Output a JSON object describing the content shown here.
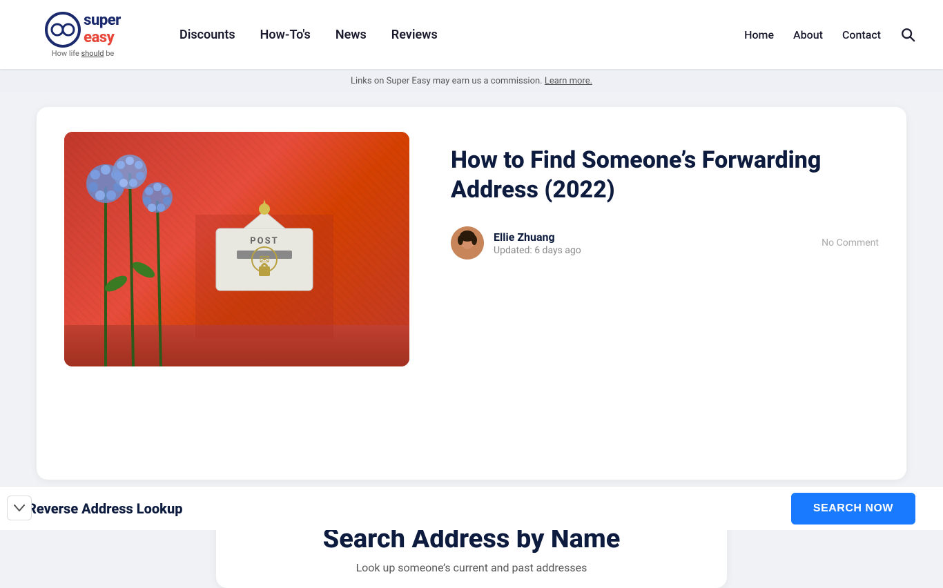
{
  "brand": {
    "super": "super",
    "easy": "easy",
    "tagline_pre": "How life ",
    "tagline_em": "should",
    "tagline_post": " be"
  },
  "nav": {
    "items": [
      {
        "label": "Discounts",
        "id": "discounts"
      },
      {
        "label": "How-To's",
        "id": "howtos"
      },
      {
        "label": "News",
        "id": "news"
      },
      {
        "label": "Reviews",
        "id": "reviews"
      }
    ],
    "right_items": [
      {
        "label": "Home",
        "id": "home"
      },
      {
        "label": "About",
        "id": "about"
      },
      {
        "label": "Contact",
        "id": "contact"
      }
    ]
  },
  "commission_bar": {
    "text": "Links on Super Easy may earn us a commission.",
    "learn_more": "Learn more."
  },
  "article": {
    "title": "How to Find Someone’s Forwarding Address (2022)",
    "author": {
      "name": "Ellie Zhuang",
      "updated": "Updated: 6 days ago"
    },
    "no_comment": "No Comment"
  },
  "search_widget": {
    "title": "Search Address by Name",
    "subtitle": "Look up someone’s current and past addresses"
  },
  "bottom_bar": {
    "title": "Reverse Address Lookup",
    "button": "SEARCH NOW"
  },
  "collapse": {
    "icon": "∨"
  }
}
